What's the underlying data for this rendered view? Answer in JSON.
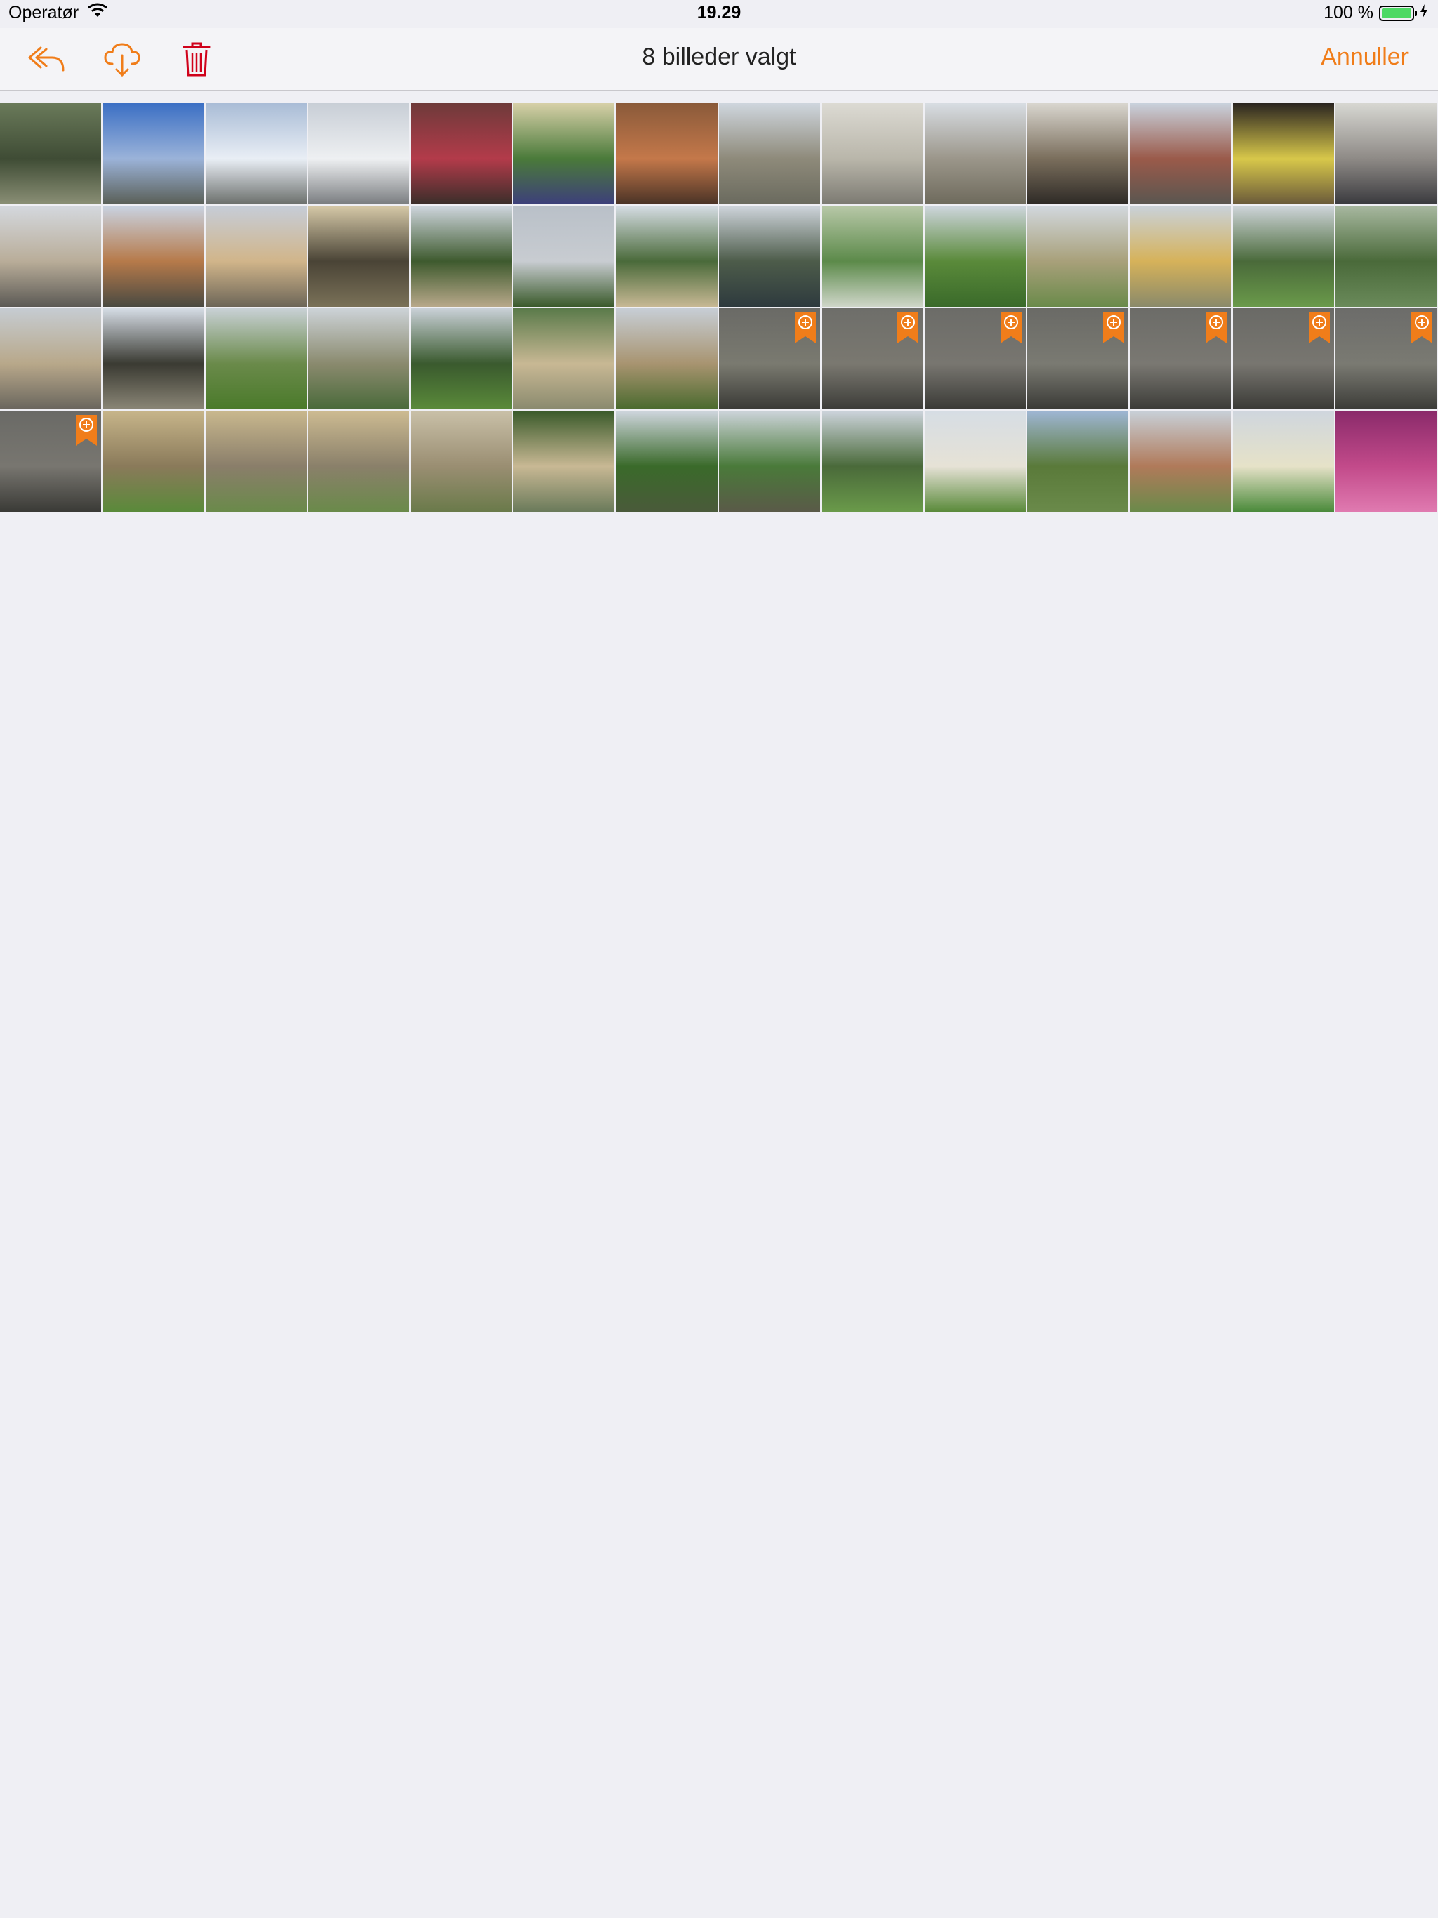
{
  "status_bar": {
    "carrier": "Operatør",
    "time": "19.29",
    "battery": "100 %"
  },
  "nav": {
    "title": "8 billeder valgt",
    "cancel_label": "Annuller",
    "icons": [
      "reply-icon",
      "cloud-download-icon",
      "trash-icon"
    ]
  },
  "colors": {
    "accent": "#f07d1a",
    "delete": "#d0021b",
    "background": "#efeff4"
  },
  "photos": [
    {
      "id": 1,
      "g": [
        "#6a7a5a",
        "#3f4c35",
        "#8a8f75"
      ],
      "selected": false
    },
    {
      "id": 2,
      "g": [
        "#3b6fc4",
        "#9bb3d9",
        "#5a5f57"
      ],
      "selected": false
    },
    {
      "id": 3,
      "g": [
        "#a9bcd6",
        "#e9eef5",
        "#6b6f6c"
      ],
      "selected": false
    },
    {
      "id": 4,
      "g": [
        "#c8ced6",
        "#eef0f2",
        "#7a7d80"
      ],
      "selected": false
    },
    {
      "id": 5,
      "g": [
        "#6e3a3a",
        "#b33b4a",
        "#3a2e2a"
      ],
      "selected": false
    },
    {
      "id": 6,
      "g": [
        "#d7d0a8",
        "#4a7a3a",
        "#3d3f7a"
      ],
      "selected": false
    },
    {
      "id": 7,
      "g": [
        "#8a5a3a",
        "#c4784a",
        "#4a3326"
      ],
      "selected": false
    },
    {
      "id": 8,
      "g": [
        "#cfd6de",
        "#8e8a7a",
        "#6a6a5e"
      ],
      "selected": false
    },
    {
      "id": 9,
      "g": [
        "#dcdad3",
        "#b9b6aa",
        "#7c7a72"
      ],
      "selected": false
    },
    {
      "id": 10,
      "g": [
        "#d8dde3",
        "#9b968a",
        "#6e6a5c"
      ],
      "selected": false
    },
    {
      "id": 11,
      "g": [
        "#d9d6cf",
        "#7a6e5c",
        "#2e2a26"
      ],
      "selected": false
    },
    {
      "id": 12,
      "g": [
        "#c9d2dd",
        "#9a5a4a",
        "#5a5650"
      ],
      "selected": false
    },
    {
      "id": 13,
      "g": [
        "#2a2420",
        "#d8c84a",
        "#6a5a3a"
      ],
      "selected": false
    },
    {
      "id": 14,
      "g": [
        "#d7d7d2",
        "#8e8a86",
        "#3a3a3e"
      ],
      "selected": false
    },
    {
      "id": 15,
      "g": [
        "#d4d8de",
        "#b9ad99",
        "#5c5a55"
      ],
      "selected": false
    },
    {
      "id": 16,
      "g": [
        "#c9d3e2",
        "#b67a4a",
        "#4a4a42"
      ],
      "selected": false
    },
    {
      "id": 17,
      "g": [
        "#c6cdd8",
        "#d1b58a",
        "#6d6658"
      ],
      "selected": false
    },
    {
      "id": 18,
      "g": [
        "#d6c9a8",
        "#4a4436",
        "#7a7158"
      ],
      "selected": false
    },
    {
      "id": 19,
      "g": [
        "#cfd6de",
        "#3e5a2e",
        "#b8a88a"
      ],
      "selected": false
    },
    {
      "id": 20,
      "g": [
        "#b9c0c8",
        "#c8ccd1",
        "#3a5a2a"
      ],
      "selected": false
    },
    {
      "id": 21,
      "g": [
        "#d6dde4",
        "#4a6a3a",
        "#c7b894"
      ],
      "selected": false
    },
    {
      "id": 22,
      "g": [
        "#cfd5dc",
        "#4d5c4a",
        "#2e3a3e"
      ],
      "selected": false
    },
    {
      "id": 23,
      "g": [
        "#b8c8a8",
        "#5c8a4a",
        "#cfd6c9"
      ],
      "selected": false
    },
    {
      "id": 24,
      "g": [
        "#cfd6de",
        "#5a8a3a",
        "#3a6a2a"
      ],
      "selected": false
    },
    {
      "id": 25,
      "g": [
        "#d2d8de",
        "#a8a07a",
        "#6a8a4a"
      ],
      "selected": false
    },
    {
      "id": 26,
      "g": [
        "#c9d2da",
        "#d6b25a",
        "#8a8a6a"
      ],
      "selected": false
    },
    {
      "id": 27,
      "g": [
        "#cfd5da",
        "#4a6a3a",
        "#6a9a4a"
      ],
      "selected": false
    },
    {
      "id": 28,
      "g": [
        "#a8b8a0",
        "#4a6a3a",
        "#6a8a5a"
      ],
      "selected": false
    },
    {
      "id": 29,
      "g": [
        "#c6ccd2",
        "#b8a88a",
        "#6a665e"
      ],
      "selected": false
    },
    {
      "id": 30,
      "g": [
        "#d6dde6",
        "#3a3a32",
        "#8a8676"
      ],
      "selected": false
    },
    {
      "id": 31,
      "g": [
        "#c9d1d6",
        "#6a8a4a",
        "#4a7a2a"
      ],
      "selected": false
    },
    {
      "id": 32,
      "g": [
        "#cdd3d8",
        "#8a8a6e",
        "#4a6a3a"
      ],
      "selected": false
    },
    {
      "id": 33,
      "g": [
        "#cad1d8",
        "#3a5a2e",
        "#5a8a3a"
      ],
      "selected": false
    },
    {
      "id": 34,
      "g": [
        "#5a7a4a",
        "#c8b894",
        "#8a8a6e"
      ],
      "selected": false
    },
    {
      "id": 35,
      "g": [
        "#c7ced6",
        "#a89470",
        "#4a6a2e"
      ],
      "selected": false
    },
    {
      "id": 36,
      "g": [
        "#6a6a66",
        "#7a7a70",
        "#3a3a36"
      ],
      "selected": true
    },
    {
      "id": 37,
      "g": [
        "#6e6e6a",
        "#7a7870",
        "#3c3c38"
      ],
      "selected": true
    },
    {
      "id": 38,
      "g": [
        "#6c6c68",
        "#787670",
        "#3a3a36"
      ],
      "selected": true
    },
    {
      "id": 39,
      "g": [
        "#6a6a66",
        "#7a7a72",
        "#3a3a36"
      ],
      "selected": true
    },
    {
      "id": 40,
      "g": [
        "#6c6c68",
        "#7a7872",
        "#3c3c38"
      ],
      "selected": true
    },
    {
      "id": 41,
      "g": [
        "#6a6a66",
        "#787670",
        "#3a3a36"
      ],
      "selected": true
    },
    {
      "id": 42,
      "g": [
        "#6c6c6a",
        "#7a7a72",
        "#3c3c38"
      ],
      "selected": true
    },
    {
      "id": 43,
      "g": [
        "#6a6a66",
        "#787670",
        "#3a3a36"
      ],
      "selected": true
    },
    {
      "id": 44,
      "g": [
        "#c7b58a",
        "#8a7a5a",
        "#5a8a3a"
      ],
      "selected": false
    },
    {
      "id": 45,
      "g": [
        "#c9b88e",
        "#8a7e6a",
        "#6a8a4a"
      ],
      "selected": false
    },
    {
      "id": 46,
      "g": [
        "#cdbb92",
        "#8a806a",
        "#6a8a4a"
      ],
      "selected": false
    },
    {
      "id": 47,
      "g": [
        "#c9c0a8",
        "#9a8e72",
        "#6a7a4a"
      ],
      "selected": false
    },
    {
      "id": 48,
      "g": [
        "#3a5a2a",
        "#c8b894",
        "#6a7a5a"
      ],
      "selected": false
    },
    {
      "id": 49,
      "g": [
        "#cfd6de",
        "#3a6a2a",
        "#4a5a3a"
      ],
      "selected": false
    },
    {
      "id": 50,
      "g": [
        "#cdd4da",
        "#4a7a3a",
        "#5a5a48"
      ],
      "selected": false
    },
    {
      "id": 51,
      "g": [
        "#cdd4dc",
        "#4a6a3a",
        "#6a9a4a"
      ],
      "selected": false
    },
    {
      "id": 52,
      "g": [
        "#d6dde4",
        "#e6e2d6",
        "#5a8a3a"
      ],
      "selected": false
    },
    {
      "id": 53,
      "g": [
        "#9fb6d4",
        "#5a7a3a",
        "#6a8a4a"
      ],
      "selected": false
    },
    {
      "id": 54,
      "g": [
        "#c8d0d8",
        "#b07a5a",
        "#6a8a4a"
      ],
      "selected": false
    },
    {
      "id": 55,
      "g": [
        "#cfd6de",
        "#e6e2c8",
        "#4a8a3a"
      ],
      "selected": false
    },
    {
      "id": 56,
      "g": [
        "#8a2a6a",
        "#c24a8a",
        "#e07ab0"
      ],
      "selected": false
    }
  ]
}
